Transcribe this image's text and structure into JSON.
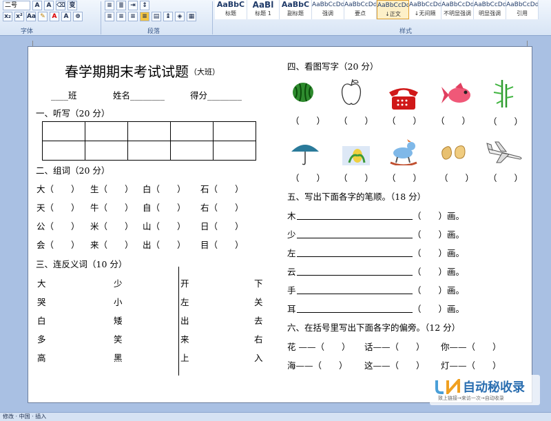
{
  "ribbon": {
    "font_group_label": "字体",
    "paragraph_group_label": "段落",
    "styles_group_label": "样式",
    "font_size": "二号",
    "styles": [
      {
        "preview": "AaBbC",
        "name": "标题"
      },
      {
        "preview": "AaBl",
        "name": "标题 1"
      },
      {
        "preview": "AaBbC",
        "name": "副标题"
      },
      {
        "preview": "AaBbCcDd",
        "name": "强调"
      },
      {
        "preview": "AaBbCcDd",
        "name": "要点"
      },
      {
        "preview": "AaBbCcDd",
        "name": "↓正文"
      },
      {
        "preview": "AaBbCcDd",
        "name": "↓无间隔"
      },
      {
        "preview": "AaBbCcDd",
        "name": "不明显强调"
      },
      {
        "preview": "AaBbCcDd",
        "name": "明显强调"
      },
      {
        "preview": "AaBbCcDd",
        "name": "引用"
      }
    ]
  },
  "status": {
    "left": "修改 · 中国 · 插入"
  },
  "watermark": {
    "text": "自动秘收录",
    "sub": "致上链接→来访一次→自动收录"
  },
  "doc": {
    "title": "春学期期末考试试题",
    "title_sub": "（大班）",
    "class_line": "____班",
    "name_line": "姓名________",
    "score_line": "得分________",
    "s1": "一、听写（20 分）",
    "s2": "二、组词（20 分）",
    "s3": "三、连反义词（10 分）",
    "s4": "四、看图写字（20 分）",
    "s5": "五、写出下面各字的笔顺。（18 分）",
    "s6": "六、在括号里写出下面各字的偏旁。（12 分）",
    "zuci": [
      [
        "大（　　）",
        "生（　　）",
        "白（　　）",
        "石（　　）"
      ],
      [
        "天（　　）",
        "牛（　　）",
        "自（　　）",
        "右（　　）"
      ],
      [
        "公（　　）",
        "米（　　）",
        "山（　　）",
        "日（　　）"
      ],
      [
        "会（　　）",
        "来（　　）",
        "出（　　）",
        "目（　　）"
      ]
    ],
    "fanyi_left": [
      [
        "大",
        "少"
      ],
      [
        "哭",
        "小"
      ],
      [
        "白",
        "矮"
      ],
      [
        "多",
        "笑"
      ],
      [
        "高",
        "黑"
      ]
    ],
    "fanyi_right": [
      [
        "开",
        "下"
      ],
      [
        "左",
        "关"
      ],
      [
        "出",
        "去"
      ],
      [
        "来",
        "右"
      ],
      [
        "上",
        "入"
      ]
    ],
    "paren": "（　　）",
    "bishun_chars": [
      "木",
      "少",
      "左",
      "云",
      "手",
      "耳"
    ],
    "bishun_tail": "（　　）画。",
    "pianpang": [
      [
        "花 ——（　　）",
        "话——（　　）",
        "你——（　　）"
      ],
      [
        "海——（　　）",
        "这——（　　）",
        "灯——（　　）"
      ]
    ]
  }
}
